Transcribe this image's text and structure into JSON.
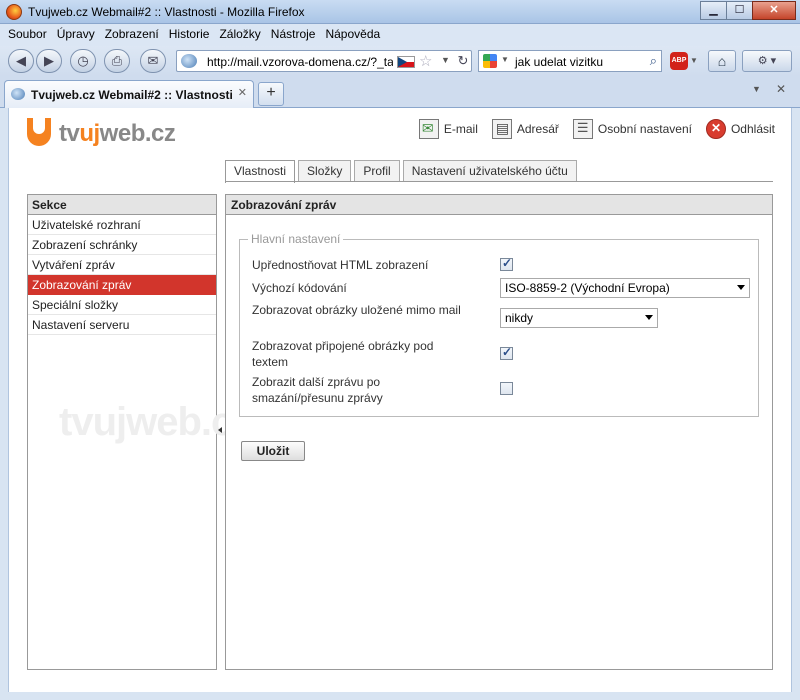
{
  "window": {
    "title": "Tvujweb.cz Webmail#2 :: Vlastnosti - Mozilla Firefox",
    "min": "▁",
    "max": "☐",
    "close": "✕"
  },
  "menu": [
    "Soubor",
    "Úpravy",
    "Zobrazení",
    "Historie",
    "Záložky",
    "Nástroje",
    "Nápověda"
  ],
  "nav": {
    "back": "◀",
    "forward": "▶",
    "history": "◷",
    "print": "⎙",
    "mail": "✉",
    "url": "http://mail.vzorova-domena.cz/?_task=settings",
    "search_text": "jak udelat vizitku",
    "reload": "↻",
    "home": "⌂",
    "tools": "⚙ ▾",
    "abp": "ABP"
  },
  "browser_tab": {
    "title": "Tvujweb.cz Webmail#2 :: Vlastnosti",
    "close": "✕",
    "new_tab": "+",
    "list": "▼",
    "close_all": "✕"
  },
  "brand": {
    "logo_pre": "tv",
    "logo_mid": "uj",
    "logo_post": "web.cz",
    "watermark": "tvujweb.cz"
  },
  "toplinks": {
    "email": "E-mail",
    "address_book": "Adresář",
    "personal": "Osobní nastavení",
    "logout": "Odhlásit"
  },
  "tabs": [
    "Vlastnosti",
    "Složky",
    "Profil",
    "Nastavení uživatelského účtu"
  ],
  "sidebar": {
    "heading": "Sekce",
    "items": [
      "Uživatelské rozhraní",
      "Zobrazení schránky",
      "Vytváření zpráv",
      "Zobrazování zpráv",
      "Speciální složky",
      "Nastavení serveru"
    ],
    "active_index": 3
  },
  "panel": {
    "heading": "Zobrazování zpráv",
    "legend": "Hlavní nastavení",
    "prefer_html_label": "Upřednostňovat HTML zobrazení",
    "prefer_html_checked": true,
    "charset_label": "Výchozí kódování",
    "charset_value": "ISO-8859-2 (Východní Evropa)",
    "remote_images_label": "Zobrazovat obrázky uložené mimo mail",
    "remote_images_value": "nikdy",
    "inline_images_label": "Zobrazovat připojené obrázky pod textem",
    "inline_images_checked": true,
    "next_message_label": "Zobrazit další zprávu po smazání/přesunu zprávy",
    "next_message_checked": false,
    "save_label": "Uložit"
  },
  "colors": {
    "brand_orange": "#f58220",
    "active_red": "#d2352c"
  }
}
